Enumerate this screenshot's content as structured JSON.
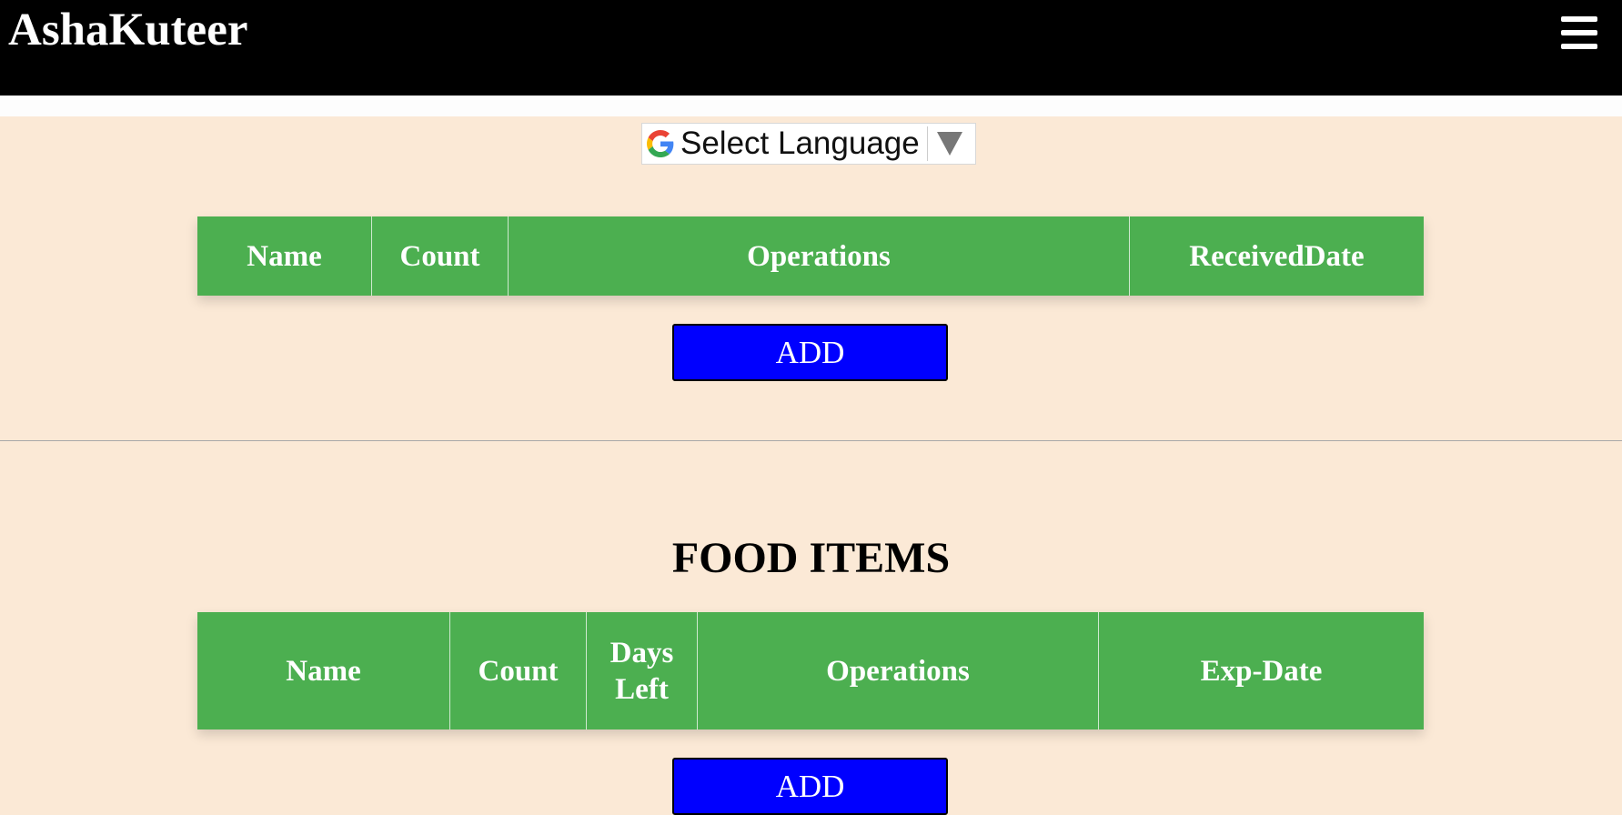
{
  "header": {
    "brand": "AshaKuteer",
    "menu_icon": "hamburger-menu-icon"
  },
  "translate": {
    "label": "Select Language",
    "icon": "google-g-icon"
  },
  "section1": {
    "columns": [
      "Name",
      "Count",
      "Operations",
      "ReceivedDate"
    ],
    "add_label": "ADD"
  },
  "section2": {
    "title": "FOOD ITEMS",
    "columns": [
      "Name",
      "Count",
      "Days Left",
      "Operations",
      "Exp-Date"
    ],
    "add_label": "ADD"
  },
  "colors": {
    "header_bg": "#000000",
    "page_bg": "#fbe9d6",
    "table_header_bg": "#4caf50",
    "button_bg": "#0000ff"
  }
}
